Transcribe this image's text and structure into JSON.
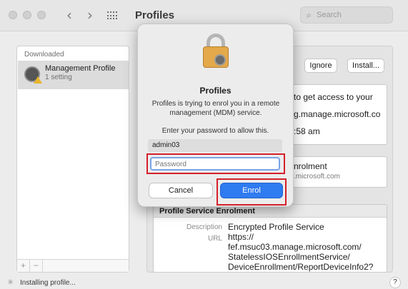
{
  "window": {
    "title": "Profiles",
    "nav_back": "‹",
    "nav_forward": "›",
    "search_placeholder": "Search"
  },
  "sidebar": {
    "section_label": "Downloaded",
    "items": [
      {
        "name": "Management Profile",
        "subtitle": "1 setting"
      }
    ],
    "add_label": "+",
    "remove_label": "−"
  },
  "detail": {
    "ignore_label": "Ignore",
    "install_label": "Install...",
    "desc_line1": "to get access to your",
    "desc_line2": "g.manage.microsoft.co",
    "desc_line3": ":58 am",
    "enrol_title": "nrolment",
    "enrol_host": ".microsoft.com",
    "section_title": "Profile Service Enrolment",
    "description_key": "Description",
    "description_value": "Encrypted Profile Service",
    "url_key": "URL",
    "url_lines": [
      "https://",
      "fef.msuc03.manage.microsoft.com/",
      "StatelessIOSEnrollmentService/",
      "DeviceEnrollment/ReportDeviceInfo2?"
    ]
  },
  "status": {
    "text": "Installing profile...",
    "help_label": "?"
  },
  "sheet": {
    "title": "Profiles",
    "message": "Profiles is trying to enrol you in a remote management (MDM) service.",
    "prompt": "Enter your password to allow this.",
    "username": "admin03",
    "password_placeholder": "Password",
    "cancel_label": "Cancel",
    "enrol_label": "Enrol"
  },
  "colors": {
    "accent": "#2f7bf0",
    "highlight": "#d4202a",
    "focus_ring": "#7aa3e6",
    "lock": "#e3a94a"
  },
  "icons": [
    "close-light-icon",
    "minimize-light-icon",
    "zoom-light-icon",
    "back-chevron-icon",
    "forward-chevron-icon",
    "grid-icon",
    "search-icon",
    "profile-gear-icon",
    "warning-icon",
    "lock-icon",
    "spinner-icon",
    "help-icon"
  ]
}
